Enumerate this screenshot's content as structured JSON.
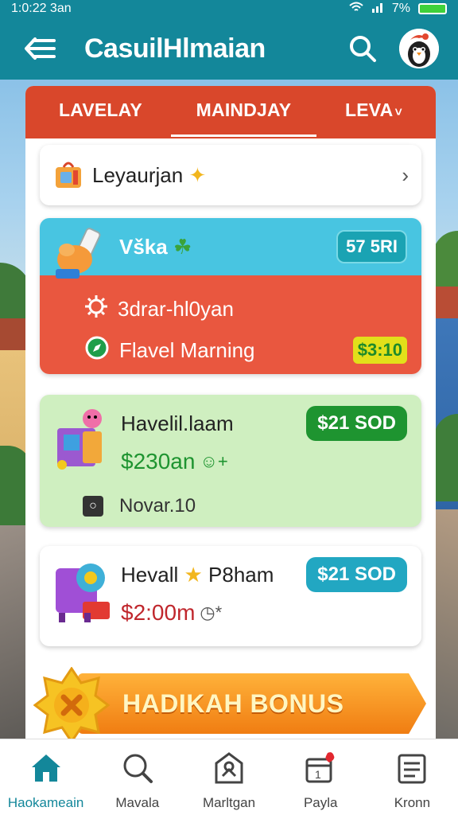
{
  "status_bar": {
    "time": "1:0:22 3an",
    "battery": "7%"
  },
  "app_bar": {
    "title": "CasuilHlmaian",
    "menu_icon": "menu-back-icon",
    "search_icon": "search-icon",
    "avatar_icon": "penguin-avatar-icon"
  },
  "tabs": [
    {
      "label": "LAVELAY",
      "active": false
    },
    {
      "label": "MAINDJAY",
      "active": true
    },
    {
      "label": "LEVA",
      "active": false
    }
  ],
  "leyaurjan_row": {
    "label": "Leyaurjan"
  },
  "promo_card": {
    "name": "Vška",
    "badge": "57 5RI",
    "line1": "3drar-hl0yan",
    "line2": "Flavel Marning",
    "line2_badge": "$3:10"
  },
  "green_card": {
    "title": "Havelil.laam",
    "badge": "$21 SOD",
    "price": "$230an",
    "date": "Novar.10"
  },
  "white_card": {
    "title_a": "Hevall",
    "title_b": "P8ham",
    "badge": "$21 SOD",
    "price": "$2:00m"
  },
  "bonus_banner": {
    "label": "HADIKAH BONUS"
  },
  "bottom_nav": [
    {
      "label": "Haokameain",
      "icon": "home-icon",
      "active": true
    },
    {
      "label": "Mavala",
      "icon": "search-icon",
      "active": false
    },
    {
      "label": "Marltgan",
      "icon": "tag-icon",
      "active": false
    },
    {
      "label": "Payla",
      "icon": "calendar-icon",
      "active": false
    },
    {
      "label": "Kronn",
      "icon": "list-icon",
      "active": false
    }
  ],
  "colors": {
    "teal": "#13879a",
    "red_tab": "#d9472b",
    "promo_cyan": "#48c5e1",
    "promo_red": "#e9573f",
    "green_card": "#cfefc0",
    "price_green": "#1e9430",
    "price_red": "#c0272d",
    "bonus_orange": "#f07d12"
  }
}
